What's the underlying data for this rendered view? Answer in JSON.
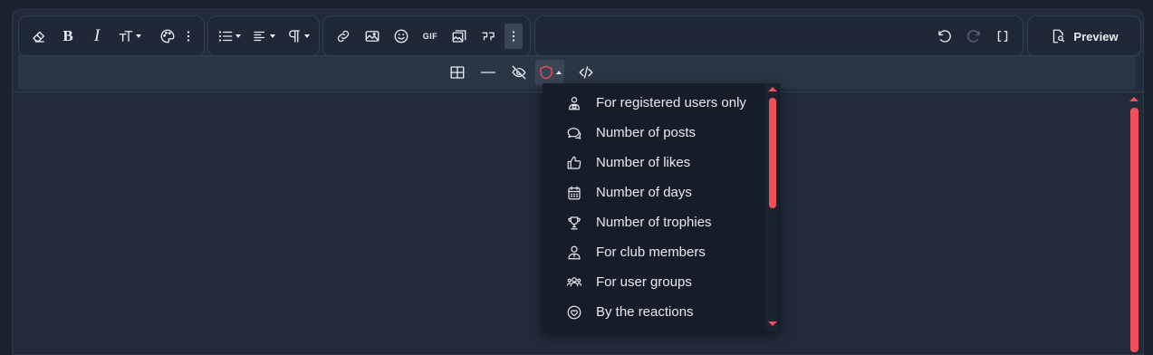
{
  "toolbar": {
    "preview_label": "Preview",
    "gif_label": "GIF",
    "bold_label": "B",
    "italic_label": "I"
  },
  "colors": {
    "background": "#1b2330",
    "toolbar_group_bg": "#1f2836",
    "accent": "#f0505a",
    "dropdown_bg": "#161d28"
  },
  "dropdown": {
    "items": [
      {
        "label": "For registered users only",
        "icon": "user-lock-icon"
      },
      {
        "label": "Number of posts",
        "icon": "comments-icon"
      },
      {
        "label": "Number of likes",
        "icon": "thumbs-up-icon"
      },
      {
        "label": "Number of days",
        "icon": "calendar-icon"
      },
      {
        "label": "Number of trophies",
        "icon": "trophy-icon"
      },
      {
        "label": "For club members",
        "icon": "user-badge-icon"
      },
      {
        "label": "For user groups",
        "icon": "users-icon"
      },
      {
        "label": "By the reactions",
        "icon": "heart-circle-icon"
      }
    ]
  }
}
